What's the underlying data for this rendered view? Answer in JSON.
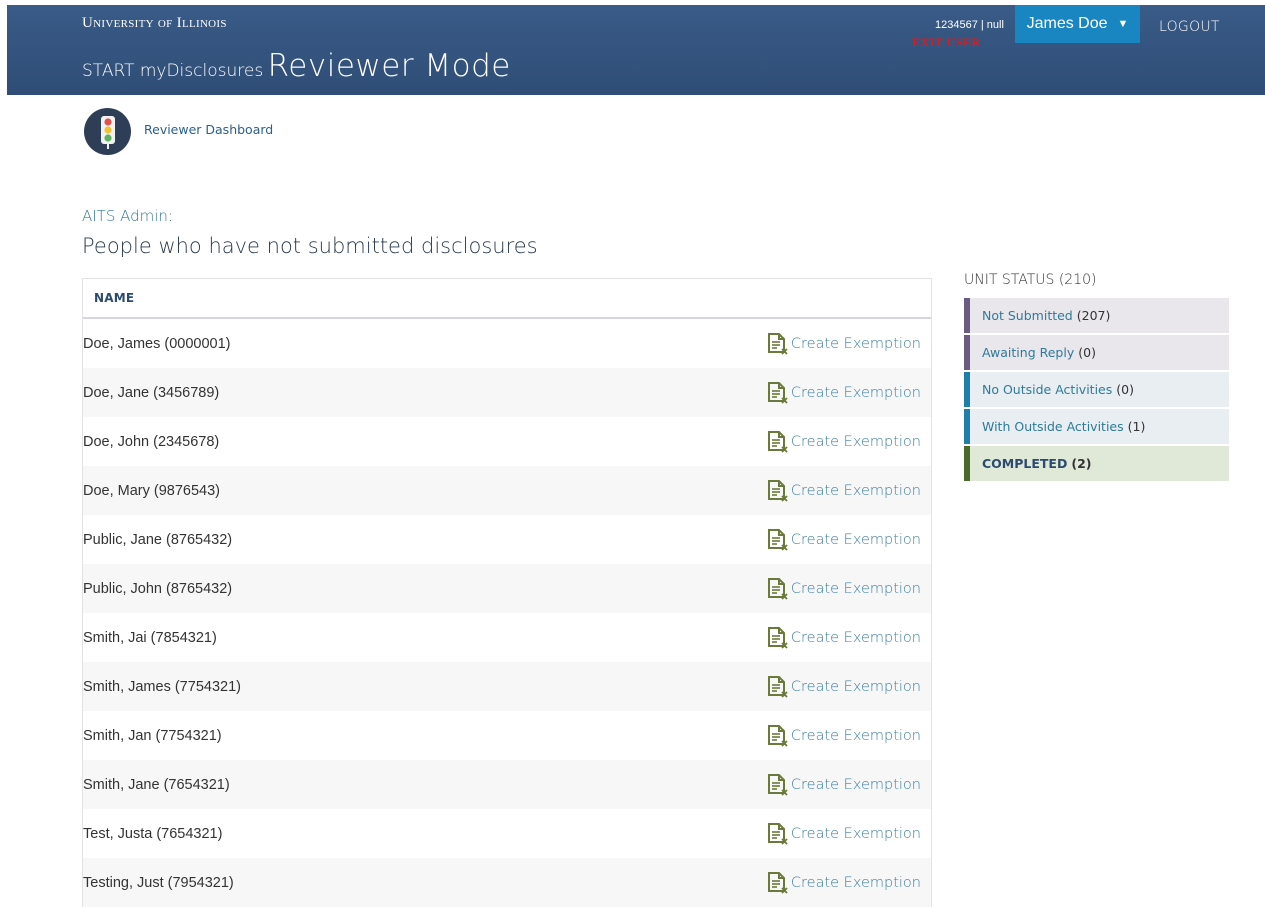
{
  "header": {
    "university": "University of Illinois",
    "brand_prefix": "START myDisclosures",
    "brand_mode": "Reviewer Mode",
    "user_id_line": "1234567  | null",
    "exit_user": "EXIT USER",
    "user_name": "James Doe",
    "logout": "LOGOUT"
  },
  "dashboard": {
    "link_label": "Reviewer Dashboard"
  },
  "unit_label": "AITS Admin",
  "page_title": "People who have not submitted disclosures",
  "table": {
    "column_header": "NAME",
    "action_label": "Create Exemption",
    "rows": [
      "Doe, James (0000001)",
      "Doe, Jane (3456789)",
      "Doe, John (2345678)",
      "Doe, Mary (9876543)",
      "Public, Jane (8765432)",
      "Public, John (8765432)",
      "Smith, Jai (7854321)",
      "Smith, James (7754321)",
      "Smith, Jan (7754321)",
      "Smith, Jane (7654321)",
      "Test, Justa (7654321)",
      "Testing, Just (7954321)"
    ]
  },
  "unit_status": {
    "title": "UNIT STATUS (210)",
    "items": [
      {
        "label": "Not Submitted",
        "count": "(207)",
        "bar": "#6b5a82",
        "bg": "#e9e6ec"
      },
      {
        "label": "Awaiting Reply",
        "count": "(0)",
        "bar": "#6b5a82",
        "bg": "#e9e6ec"
      },
      {
        "label": "No Outside Activities",
        "count": "(0)",
        "bar": "#1e7fa8",
        "bg": "#e8eef2"
      },
      {
        "label": "With Outside Activities",
        "count": "(1)",
        "bar": "#1e7fa8",
        "bg": "#e8eef2"
      },
      {
        "label": "COMPLETED",
        "count": "(2)",
        "bar": "#4a6a2a",
        "bg": "#e0e8d8"
      }
    ]
  },
  "colors": {
    "header_bg": "#34557f",
    "user_button": "#1a86c1",
    "exit_user": "#e11919",
    "icon_green": "#6a7a3a",
    "link": "#3d7ea0"
  }
}
